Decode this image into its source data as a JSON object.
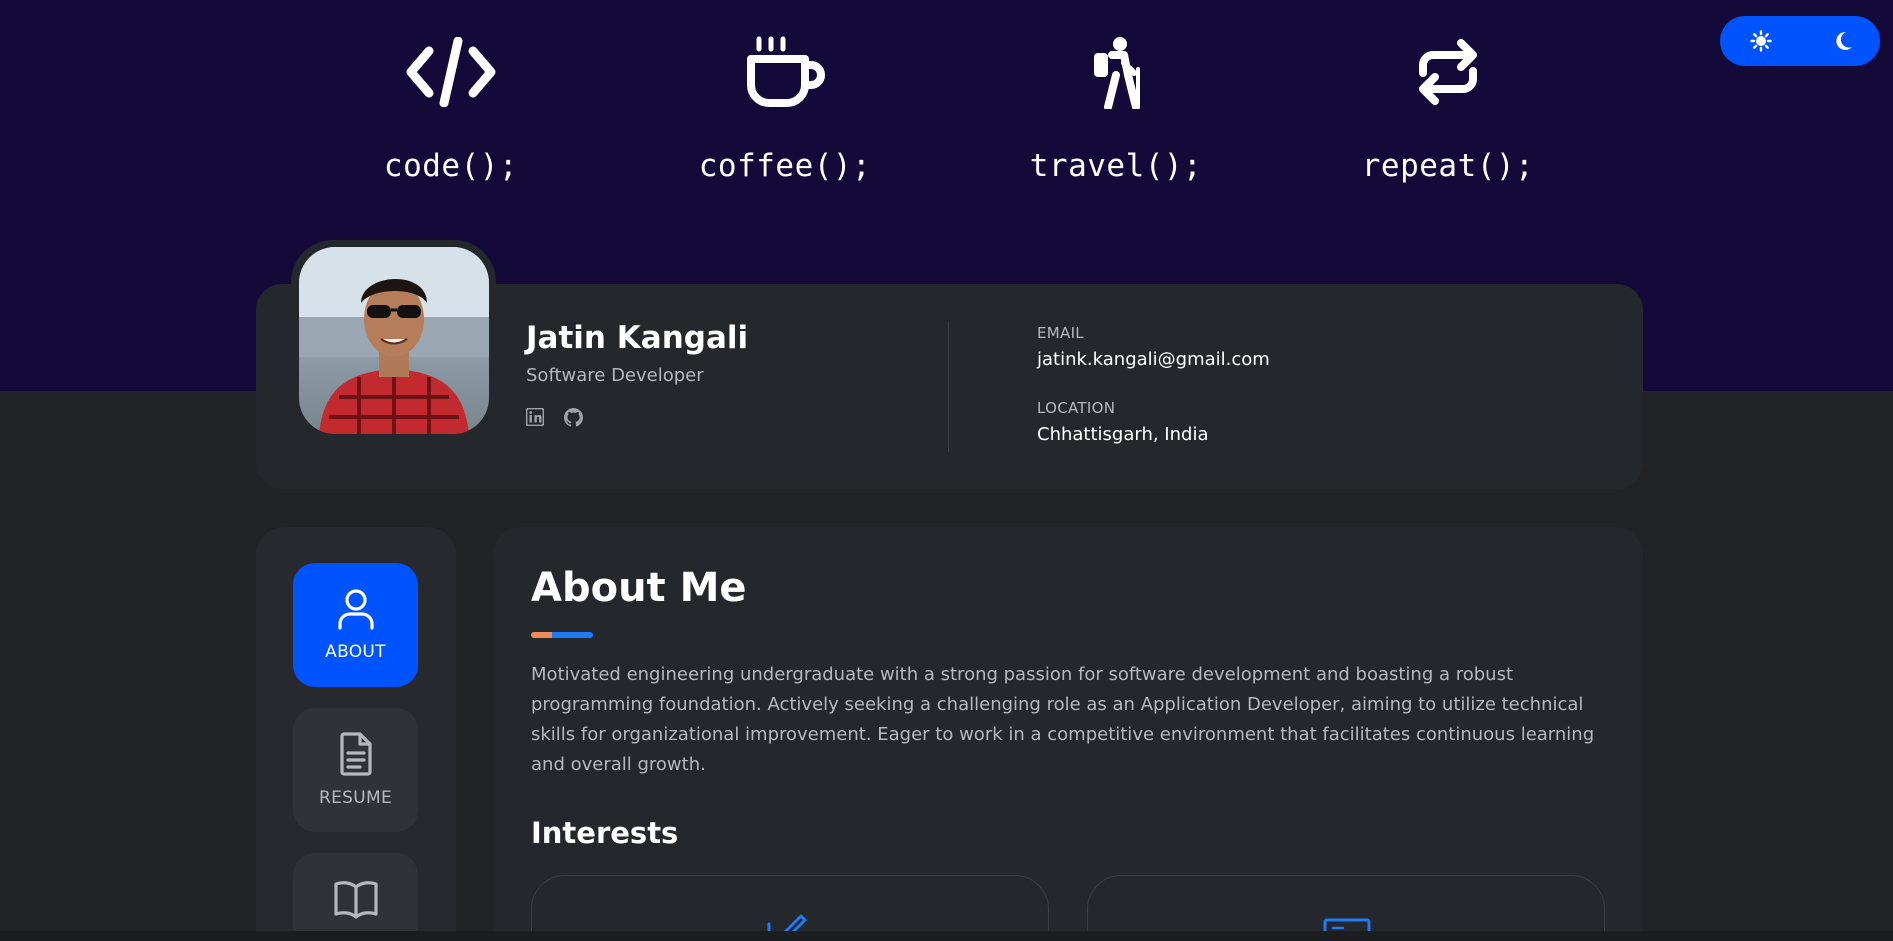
{
  "hobbies": [
    {
      "icon": "code-icon",
      "label": "code();"
    },
    {
      "icon": "coffee-icon",
      "label": "coffee();"
    },
    {
      "icon": "hiking-icon",
      "label": "travel();"
    },
    {
      "icon": "repeat-icon",
      "label": "repeat();"
    }
  ],
  "theme_toggle": {
    "light_icon": "sun-icon",
    "dark_icon": "moon-icon"
  },
  "profile": {
    "name": "Jatin Kangali",
    "role": "Software Developer",
    "social": [
      {
        "icon": "linkedin-icon"
      },
      {
        "icon": "github-icon"
      }
    ],
    "email_label": "EMAIL",
    "email": "jatink.kangali@gmail.com",
    "location_label": "LOCATION",
    "location": "Chhattisgarh, India"
  },
  "nav": [
    {
      "label": "ABOUT",
      "icon": "user-icon",
      "active": true
    },
    {
      "label": "RESUME",
      "icon": "document-icon",
      "active": false
    },
    {
      "label": "",
      "icon": "book-icon",
      "active": false
    }
  ],
  "about": {
    "title": "About Me",
    "text": "Motivated engineering undergraduate with a strong passion for software development and boasting a robust programming foundation. Actively seeking a challenging role as an Application Developer, aiming to utilize technical skills for organizational improvement. Eager to work in a competitive environment that facilitates continuous learning and overall growth.",
    "interests_title": "Interests"
  },
  "colors": {
    "hero_bg": "#130a3a",
    "page_bg": "#212327",
    "card_bg": "#24272b",
    "accent": "#0054ff",
    "accent_orange": "#f0895a",
    "accent_blue": "#1f7af5",
    "muted_text": "#b6b8bd"
  }
}
